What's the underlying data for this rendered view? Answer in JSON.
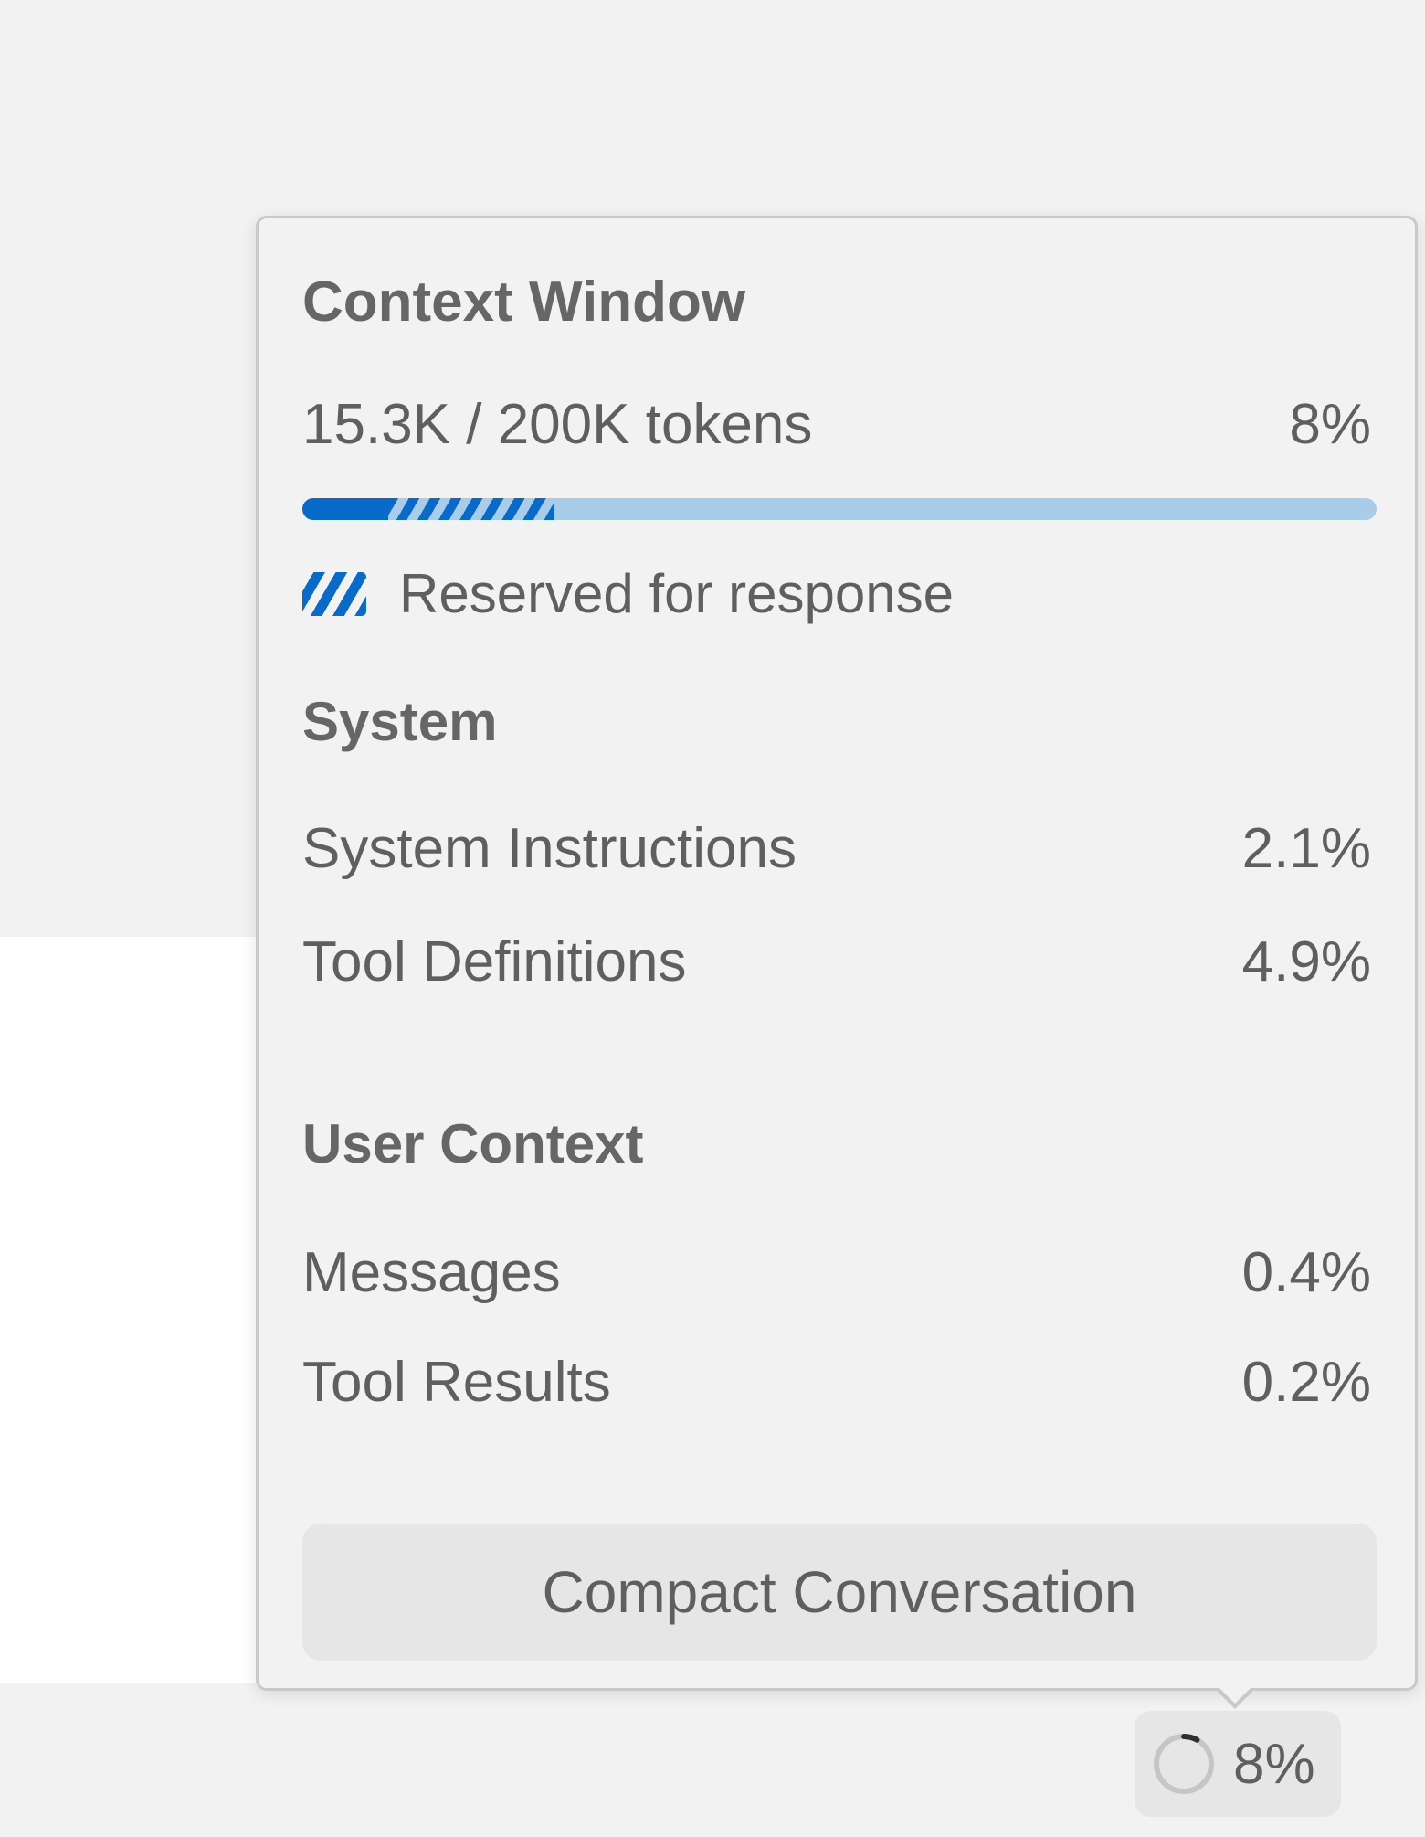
{
  "context_window": {
    "title": "Context Window",
    "usage_text": "15.3K / 200K tokens",
    "usage_percent_text": "8%",
    "used_fraction": 0.08,
    "reserved_fraction": 0.155,
    "reserved_legend": "Reserved for response"
  },
  "sections": {
    "system": {
      "heading": "System",
      "items": [
        {
          "label": "System Instructions",
          "value": "2.1%"
        },
        {
          "label": "Tool Definitions",
          "value": "4.9%"
        }
      ]
    },
    "user_context": {
      "heading": "User Context",
      "items": [
        {
          "label": "Messages",
          "value": "0.4%"
        },
        {
          "label": "Tool Results",
          "value": "0.2%"
        }
      ]
    }
  },
  "actions": {
    "compact_label": "Compact Conversation"
  },
  "status_chip": {
    "percent_text": "8%",
    "progress_fraction": 0.08
  },
  "colors": {
    "accent": "#0a6ac9",
    "track": "#a9cde8",
    "background": "#f2f2f2"
  },
  "icons": {
    "reserved": "striped-swatch-icon",
    "context_usage": "progress-ring-icon"
  }
}
